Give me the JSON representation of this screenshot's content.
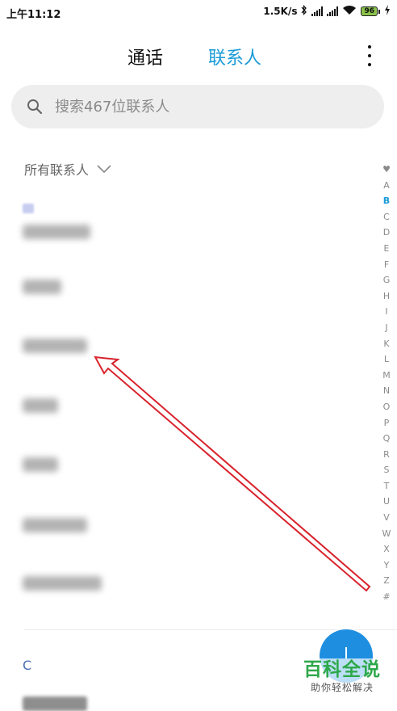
{
  "status_bar": {
    "time": "上午11:12",
    "speed": "1.5K/s",
    "battery": "96"
  },
  "header": {
    "tabs": [
      {
        "label": "通话",
        "active": false
      },
      {
        "label": "联系人",
        "active": true
      }
    ],
    "accent_color": "#1a9bd7"
  },
  "search": {
    "placeholder": "搜索467位联系人"
  },
  "filter": {
    "label": "所有联系人"
  },
  "contacts": {
    "section_c": "C"
  },
  "index_bar": {
    "letters": [
      "A",
      "B",
      "C",
      "D",
      "E",
      "F",
      "G",
      "H",
      "I",
      "J",
      "K",
      "L",
      "M",
      "N",
      "O",
      "P",
      "Q",
      "R",
      "S",
      "T",
      "U",
      "V",
      "W",
      "X",
      "Y",
      "Z",
      "#"
    ],
    "active": "B"
  },
  "watermark": {
    "title": "百科全说",
    "subtitle": "助你轻松解决"
  },
  "colors": {
    "fab": "#1e8fe0",
    "arrow": "#d9232d",
    "watermark_green": "#2ea84a"
  }
}
